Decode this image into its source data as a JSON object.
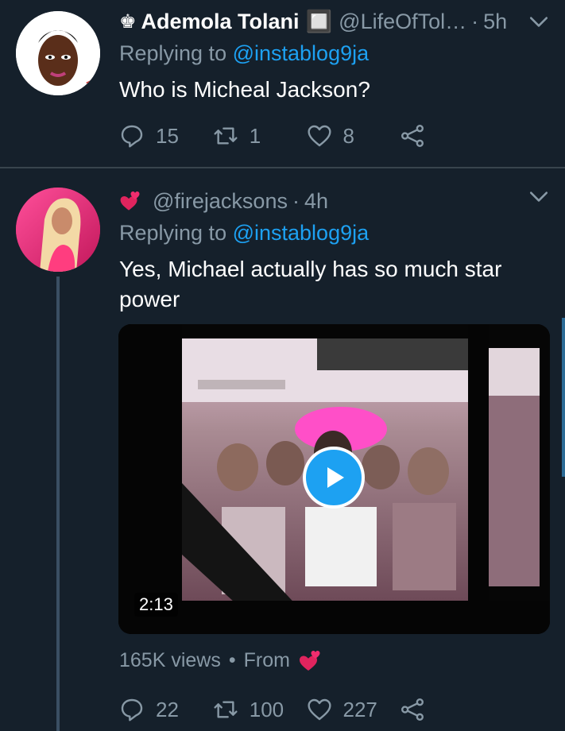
{
  "tweets": [
    {
      "author_name": "Ademola Tolani",
      "name_emoji": "🔲",
      "handle": "@LifeOfTol…",
      "separator": "·",
      "time": "5h",
      "replying_prefix": "Replying to ",
      "replying_to": "@instablog9ja",
      "text": "Who is Micheal Jackson?",
      "replies": "15",
      "retweets": "1",
      "likes": "8",
      "icons": [
        "crown-icon",
        "reply-icon",
        "retweet-icon",
        "like-icon",
        "share-icon",
        "chevron-down-icon"
      ]
    },
    {
      "handle": "@firejacksons",
      "separator": "·",
      "time": "4h",
      "replying_prefix": "Replying to ",
      "replying_to": "@instablog9ja",
      "text": "Yes, Michael actually has so much star power",
      "video": {
        "duration": "2:13"
      },
      "views": "165K views",
      "meta_separator": "•",
      "from_label": "From",
      "replies": "22",
      "retweets": "100",
      "likes": "227",
      "icons": [
        "two-hearts-icon",
        "play-icon",
        "reply-icon",
        "retweet-icon",
        "like-icon",
        "share-icon",
        "chevron-down-icon"
      ]
    }
  ],
  "colors": {
    "background": "#15202b",
    "secondary_text": "#8899a6",
    "accent": "#1da1f2",
    "divider": "#38444d",
    "heart_emoji": "#e0245e"
  }
}
